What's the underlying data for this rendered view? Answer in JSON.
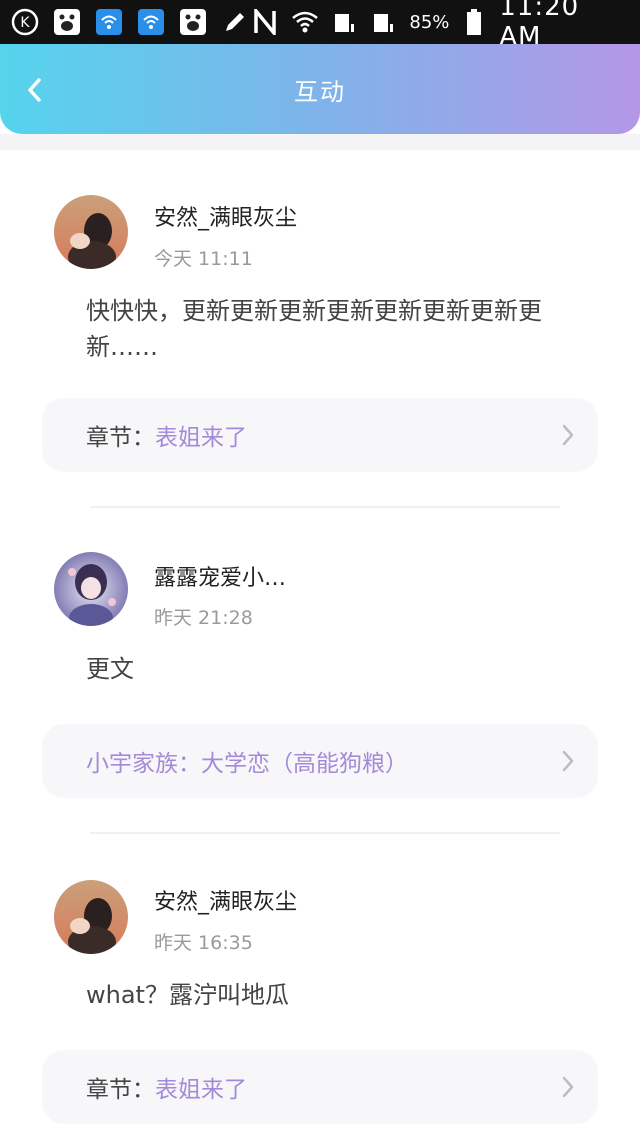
{
  "status_bar": {
    "battery": "85%",
    "time": "11:20 AM"
  },
  "header": {
    "title": "互动"
  },
  "posts": [
    {
      "username": "安然_满眼灰尘",
      "time": "今天 11:11",
      "content": "快快快，更新更新更新更新更新更新更新更新……",
      "chapter_label": "章节：",
      "chapter_title": "表姐来了"
    },
    {
      "username": "露露宠爱小…",
      "time": "昨天 21:28",
      "content": "更文",
      "chapter_label": "",
      "chapter_title": "小宇家族：大学恋（高能狗粮）"
    },
    {
      "username": "安然_满眼灰尘",
      "time": "昨天 16:35",
      "content": "what？露泞叫地瓜",
      "chapter_label": "章节：",
      "chapter_title": "表姐来了"
    }
  ]
}
